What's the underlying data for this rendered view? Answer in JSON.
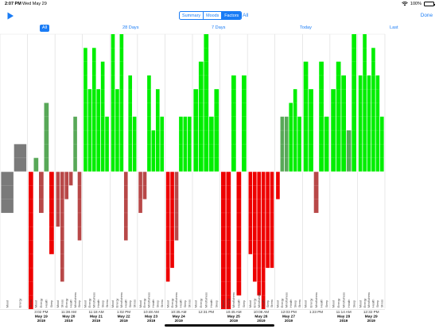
{
  "status_bar": {
    "time": "2:07 PM",
    "date": "Wed May 29",
    "battery": "100%"
  },
  "toolbar": {
    "segments": [
      {
        "label": "Summary",
        "active": false
      },
      {
        "label": "Moods",
        "active": false
      },
      {
        "label": "Factors",
        "active": true
      }
    ],
    "all_label": "All",
    "done_label": "Done"
  },
  "range_bar": {
    "all": "All",
    "days28": "28 Days",
    "days7": "7 Days",
    "today": "Today",
    "last": "Last"
  },
  "colors": {
    "positive_bright": "#00ee00",
    "positive_muted": "#58a858",
    "negative_bright": "#ee0000",
    "negative_muted": "#b84848",
    "neutral": "#7a7a7a",
    "accent": "#1a7cf5"
  },
  "chart_data": {
    "type": "bar",
    "ylim": [
      -10,
      10
    ],
    "factor_names": [
      "Mood",
      "Energy",
      "Mindfulness",
      "Health",
      "Sleep",
      "Stress"
    ],
    "sessions": [
      {
        "time": "",
        "date_line": "",
        "year": "",
        "bars": [
          {
            "factor": "Mood",
            "value": -3,
            "tone": "neutral"
          },
          {
            "factor": "Energy",
            "value": 2,
            "tone": "neutral"
          }
        ]
      },
      {
        "time": "3:02 PM",
        "date_line": "May 19",
        "year": "2019",
        "bars": [
          {
            "factor": "Stress",
            "value": -10,
            "tone": "bright"
          },
          {
            "factor": "Mood",
            "value": 1,
            "tone": "muted"
          },
          {
            "factor": "Energy",
            "value": -3,
            "tone": "muted"
          },
          {
            "factor": "Health",
            "value": 5,
            "tone": "muted"
          },
          {
            "factor": "Sleep",
            "value": -6,
            "tone": "bright"
          }
        ]
      },
      {
        "time": "11:38 AM",
        "date_line": "May 20",
        "year": "2019",
        "bars": [
          {
            "factor": "Mood",
            "value": -4,
            "tone": "muted"
          },
          {
            "factor": "Stress",
            "value": -8,
            "tone": "muted"
          },
          {
            "factor": "Energy",
            "value": -2,
            "tone": "muted"
          },
          {
            "factor": "Health",
            "value": -1,
            "tone": "muted"
          },
          {
            "factor": "Mindfulness",
            "value": 4,
            "tone": "muted"
          },
          {
            "factor": "Sleep",
            "value": -5,
            "tone": "muted"
          }
        ]
      },
      {
        "time": "11:18 AM",
        "date_line": "May 21",
        "year": "2019",
        "bars": [
          {
            "factor": "Mood",
            "value": 9,
            "tone": "bright"
          },
          {
            "factor": "Energy",
            "value": 6,
            "tone": "bright"
          },
          {
            "factor": "Mindfulness",
            "value": 9,
            "tone": "bright"
          },
          {
            "factor": "Health",
            "value": 6,
            "tone": "bright"
          },
          {
            "factor": "Sleep",
            "value": 8,
            "tone": "bright"
          },
          {
            "factor": "Stress",
            "value": 4,
            "tone": "bright"
          }
        ]
      },
      {
        "time": "1:02 PM",
        "date_line": "May 22",
        "year": "2019",
        "bars": [
          {
            "factor": "Mood",
            "value": 10,
            "tone": "bright"
          },
          {
            "factor": "Energy",
            "value": 6,
            "tone": "bright"
          },
          {
            "factor": "Mindfulness",
            "value": 10,
            "tone": "bright"
          },
          {
            "factor": "Health",
            "value": -5,
            "tone": "muted"
          },
          {
            "factor": "Sleep",
            "value": 7,
            "tone": "bright"
          },
          {
            "factor": "Stress",
            "value": 4,
            "tone": "bright"
          }
        ]
      },
      {
        "time": "10:48 AM",
        "date_line": "May 23",
        "year": "2019",
        "bars": [
          {
            "factor": "Mood",
            "value": -3,
            "tone": "muted"
          },
          {
            "factor": "Energy",
            "value": -2,
            "tone": "muted"
          },
          {
            "factor": "Mindfulness",
            "value": 7,
            "tone": "bright"
          },
          {
            "factor": "Health",
            "value": 3,
            "tone": "bright"
          },
          {
            "factor": "Sleep",
            "value": 6,
            "tone": "bright"
          },
          {
            "factor": "Stress",
            "value": 4,
            "tone": "bright"
          }
        ]
      },
      {
        "time": "10:35 AM",
        "date_line": "May 24",
        "year": "2019",
        "bars": [
          {
            "factor": "Mood",
            "value": -8,
            "tone": "bright"
          },
          {
            "factor": "Energy",
            "value": -7,
            "tone": "bright"
          },
          {
            "factor": "Mindfulness",
            "value": -5,
            "tone": "muted"
          },
          {
            "factor": "Health",
            "value": 4,
            "tone": "bright"
          },
          {
            "factor": "Sleep",
            "value": 4,
            "tone": "bright"
          },
          {
            "factor": "Stress",
            "value": 4,
            "tone": "bright"
          }
        ]
      },
      {
        "time": "12:31 PM",
        "date_line": "",
        "year": "",
        "bars": [
          {
            "factor": "Mood",
            "value": 6,
            "tone": "bright"
          },
          {
            "factor": "Energy",
            "value": 8,
            "tone": "bright"
          },
          {
            "factor": "Mindfulness",
            "value": 10,
            "tone": "bright"
          },
          {
            "factor": "Health",
            "value": 4,
            "tone": "bright"
          },
          {
            "factor": "Sleep",
            "value": 6,
            "tone": "bright"
          }
        ]
      },
      {
        "time": "10:45 AM",
        "date_line": "May 25",
        "year": "2019",
        "bars": [
          {
            "factor": "Mood",
            "value": -10,
            "tone": "bright"
          },
          {
            "factor": "Energy",
            "value": -10,
            "tone": "bright"
          },
          {
            "factor": "Mindfulness",
            "value": 7,
            "tone": "bright"
          },
          {
            "factor": "Health",
            "value": -9,
            "tone": "bright"
          },
          {
            "factor": "Sleep",
            "value": 7,
            "tone": "bright"
          }
        ]
      },
      {
        "time": "10:08 AM",
        "date_line": "May 26",
        "year": "2019",
        "bars": [
          {
            "factor": "Mood",
            "value": -6,
            "tone": "bright"
          },
          {
            "factor": "Energy",
            "value": -8,
            "tone": "bright"
          },
          {
            "factor": "Mindfulness",
            "value": -9,
            "tone": "bright"
          },
          {
            "factor": "Health",
            "value": -10,
            "tone": "bright"
          },
          {
            "factor": "Sleep",
            "value": -7,
            "tone": "bright"
          },
          {
            "factor": "Stress",
            "value": -7,
            "tone": "bright"
          }
        ]
      },
      {
        "time": "12:03 PM",
        "date_line": "May 27",
        "year": "2019",
        "bars": [
          {
            "factor": "Mood",
            "value": -2,
            "tone": "bright"
          },
          {
            "factor": "Energy",
            "value": 4,
            "tone": "muted"
          },
          {
            "factor": "Mindfulness",
            "value": 4,
            "tone": "muted"
          },
          {
            "factor": "Health",
            "value": 5,
            "tone": "bright"
          },
          {
            "factor": "Sleep",
            "value": 6,
            "tone": "bright"
          },
          {
            "factor": "Stress",
            "value": 4,
            "tone": "bright"
          }
        ]
      },
      {
        "time": "1:23 PM",
        "date_line": "",
        "year": "",
        "bars": [
          {
            "factor": "Mood",
            "value": 8,
            "tone": "bright"
          },
          {
            "factor": "Energy",
            "value": 6,
            "tone": "bright"
          },
          {
            "factor": "Mindfulness",
            "value": -3,
            "tone": "muted"
          },
          {
            "factor": "Health",
            "value": 8,
            "tone": "bright"
          },
          {
            "factor": "Sleep",
            "value": 4,
            "tone": "bright"
          }
        ]
      },
      {
        "time": "11:14 AM",
        "date_line": "May 28",
        "year": "2019",
        "bars": [
          {
            "factor": "Mood",
            "value": 6,
            "tone": "bright"
          },
          {
            "factor": "Energy",
            "value": 8,
            "tone": "bright"
          },
          {
            "factor": "Mindfulness",
            "value": 7,
            "tone": "bright"
          },
          {
            "factor": "Health",
            "value": 3,
            "tone": "muted"
          },
          {
            "factor": "Sleep",
            "value": 10,
            "tone": "bright"
          }
        ]
      },
      {
        "time": "12:32 PM",
        "date_line": "May 29",
        "year": "2019",
        "bars": [
          {
            "factor": "Mood",
            "value": 7,
            "tone": "bright"
          },
          {
            "factor": "Energy",
            "value": 10,
            "tone": "bright"
          },
          {
            "factor": "Mindfulness",
            "value": 7,
            "tone": "bright"
          },
          {
            "factor": "Health",
            "value": 9,
            "tone": "bright"
          },
          {
            "factor": "Sleep",
            "value": 7,
            "tone": "bright"
          },
          {
            "factor": "Stress",
            "value": 4,
            "tone": "bright"
          }
        ]
      }
    ]
  }
}
